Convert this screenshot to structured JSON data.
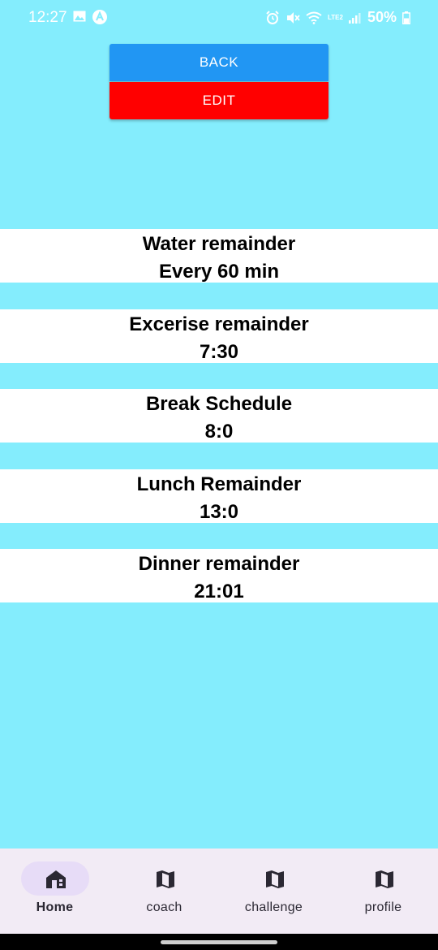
{
  "status": {
    "time": "12:27",
    "battery": "50%",
    "network": "LTE2"
  },
  "buttons": {
    "back": "BACK",
    "edit": "EDIT"
  },
  "reminders": [
    {
      "title": "Water remainder",
      "value": "Every 60 min"
    },
    {
      "title": "Excerise remainder",
      "value": "7:30"
    },
    {
      "title": "Break Schedule",
      "value": "8:0"
    },
    {
      "title": "Lunch Remainder",
      "value": "13:0"
    },
    {
      "title": "Dinner remainder",
      "value": "21:01"
    }
  ],
  "nav": {
    "items": [
      {
        "label": "Home",
        "icon": "home-icon",
        "active": true
      },
      {
        "label": "coach",
        "icon": "map-icon",
        "active": false
      },
      {
        "label": "challenge",
        "icon": "map-icon",
        "active": false
      },
      {
        "label": "profile",
        "icon": "map-icon",
        "active": false
      }
    ]
  },
  "colors": {
    "background": "#84edfd",
    "back_button": "#2196f3",
    "edit_button": "#ff0000",
    "nav_background": "#f2ebf5",
    "nav_active_pill": "#e7dcf7"
  }
}
